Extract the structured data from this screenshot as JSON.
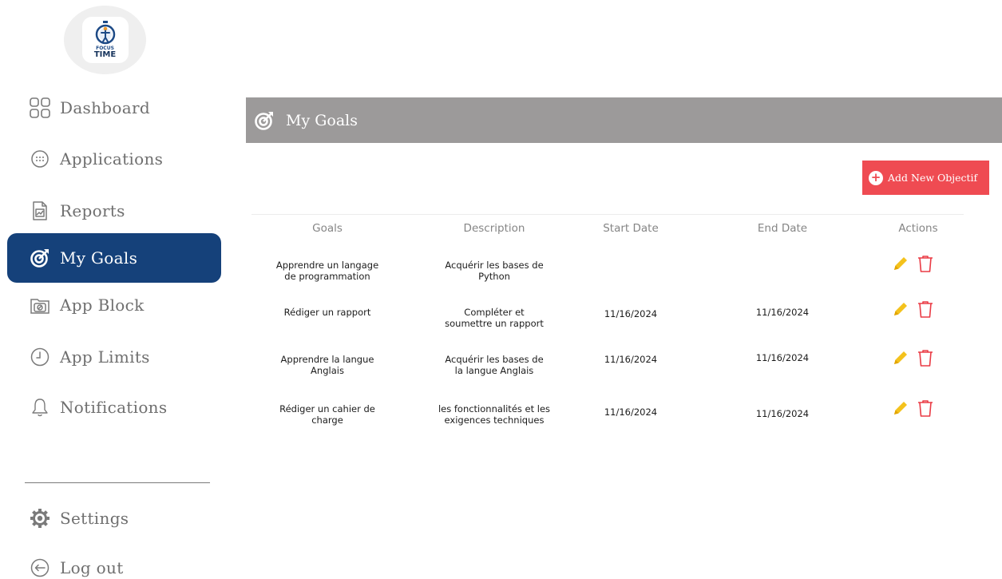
{
  "app": {
    "logo_line1": "FOCUS",
    "logo_line2": "TIME"
  },
  "sidebar": {
    "items": [
      {
        "label": "Dashboard",
        "icon": "dashboard-grid-icon"
      },
      {
        "label": "Applications",
        "icon": "apps-icon"
      },
      {
        "label": "Reports",
        "icon": "report-icon"
      },
      {
        "label": "My Goals",
        "icon": "target-icon",
        "active": true
      },
      {
        "label": "App Block",
        "icon": "app-block-icon"
      },
      {
        "label": "App Limits",
        "icon": "clock-icon"
      },
      {
        "label": "Notifications",
        "icon": "bell-icon"
      }
    ],
    "settings_label": "Settings",
    "logout_label": "Log out"
  },
  "header": {
    "title": "My Goals",
    "icon": "target-icon"
  },
  "add_button": {
    "label": "Add New Objectif",
    "icon": "plus-circle-icon"
  },
  "table": {
    "columns": [
      "Goals",
      "Description",
      "Start Date",
      "End Date",
      "Actions"
    ],
    "rows": [
      {
        "goal": [
          "Apprendre un langage",
          "de programmation"
        ],
        "description": [
          "Acquérir les bases de",
          "Python"
        ],
        "start": "",
        "end": ""
      },
      {
        "goal": [
          "Rédiger un rapport",
          ""
        ],
        "description": [
          "Compléter et",
          "soumettre un rapport"
        ],
        "start": "11/16/2024",
        "end": "11/16/2024"
      },
      {
        "goal": [
          "Apprendre la langue",
          "Anglais"
        ],
        "description": [
          "Acquérir les bases de",
          "la langue Anglais"
        ],
        "start": "11/16/2024",
        "end": "11/16/2024"
      },
      {
        "goal": [
          "Rédiger un cahier de",
          "charge"
        ],
        "description": [
          "les fonctionnalités et les",
          "exigences techniques"
        ],
        "start": "11/16/2024",
        "end": "11/16/2024"
      }
    ]
  },
  "colors": {
    "sidebar_active": "#15417a",
    "header_bg": "#9c9a9a",
    "add_button": "#ef4b52",
    "edit_icon": "#f4c21c",
    "delete_icon": "#ea3b45"
  }
}
